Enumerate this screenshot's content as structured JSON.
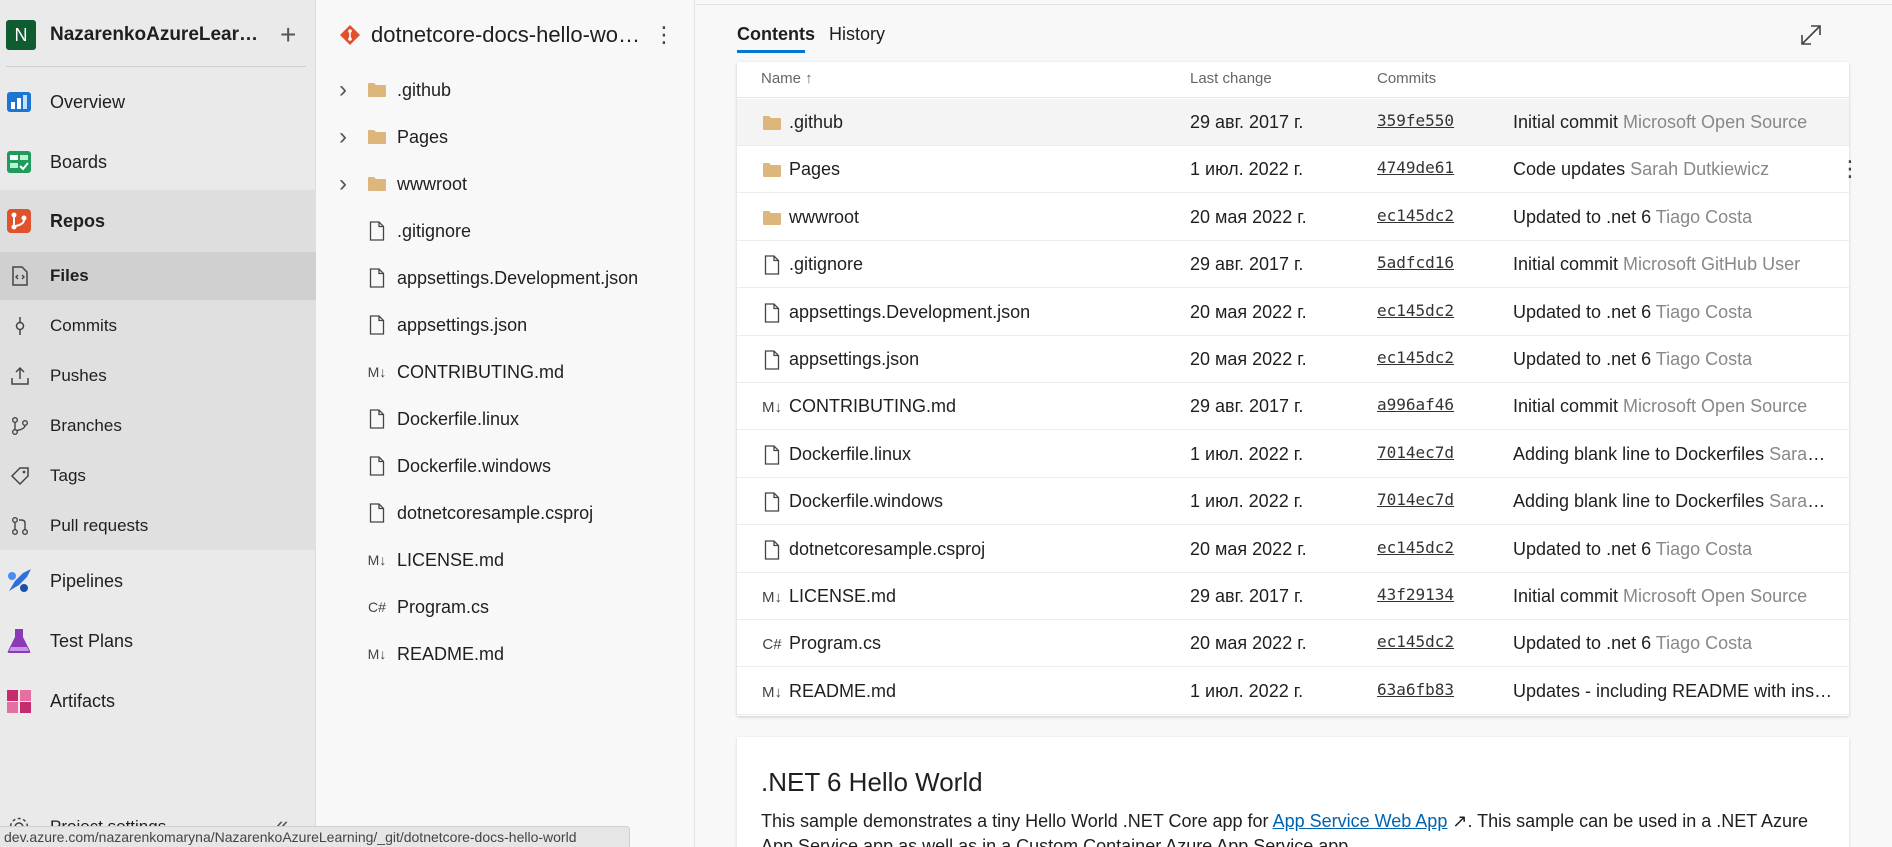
{
  "org": {
    "initial": "N",
    "name": "NazarenkoAzureLearning",
    "add_icon": "plus-icon"
  },
  "nav": {
    "overview": "Overview",
    "boards": "Boards",
    "repos": "Repos",
    "files": "Files",
    "commits": "Commits",
    "pushes": "Pushes",
    "branches": "Branches",
    "tags": "Tags",
    "pull_requests": "Pull requests",
    "pipelines": "Pipelines",
    "test_plans": "Test Plans",
    "artifacts": "Artifacts",
    "project_settings": "Project settings"
  },
  "repo": {
    "name": "dotnetcore-docs-hello-world"
  },
  "tree": [
    {
      "name": ".github",
      "type": "folder"
    },
    {
      "name": "Pages",
      "type": "folder"
    },
    {
      "name": "wwwroot",
      "type": "folder"
    },
    {
      "name": ".gitignore",
      "type": "file"
    },
    {
      "name": "appsettings.Development.json",
      "type": "file"
    },
    {
      "name": "appsettings.json",
      "type": "file"
    },
    {
      "name": "CONTRIBUTING.md",
      "type": "md"
    },
    {
      "name": "Dockerfile.linux",
      "type": "file"
    },
    {
      "name": "Dockerfile.windows",
      "type": "file"
    },
    {
      "name": "dotnetcoresample.csproj",
      "type": "file"
    },
    {
      "name": "LICENSE.md",
      "type": "md"
    },
    {
      "name": "Program.cs",
      "type": "cs"
    },
    {
      "name": "README.md",
      "type": "md"
    }
  ],
  "tabs": {
    "contents": "Contents",
    "history": "History"
  },
  "grid": {
    "headers": {
      "name": "Name ↑",
      "last_change": "Last change",
      "commits": "Commits"
    },
    "rows": [
      {
        "name": ".github",
        "type": "folder",
        "date": "29 авг. 2017 г.",
        "hash": "359fe550",
        "msg": "Initial commit",
        "author": "Microsoft Open Source"
      },
      {
        "name": "Pages",
        "type": "folder",
        "date": "1 июл. 2022 г.",
        "hash": "4749de61",
        "msg": "Code updates",
        "author": "Sarah Dutkiewicz"
      },
      {
        "name": "wwwroot",
        "type": "folder",
        "date": "20 мая 2022 г.",
        "hash": "ec145dc2",
        "msg": "Updated to .net 6",
        "author": "Tiago Costa"
      },
      {
        "name": ".gitignore",
        "type": "file",
        "date": "29 авг. 2017 г.",
        "hash": "5adfcd16",
        "msg": "Initial commit",
        "author": "Microsoft GitHub User"
      },
      {
        "name": "appsettings.Development.json",
        "type": "file",
        "date": "20 мая 2022 г.",
        "hash": "ec145dc2",
        "msg": "Updated to .net 6",
        "author": "Tiago Costa"
      },
      {
        "name": "appsettings.json",
        "type": "file",
        "date": "20 мая 2022 г.",
        "hash": "ec145dc2",
        "msg": "Updated to .net 6",
        "author": "Tiago Costa"
      },
      {
        "name": "CONTRIBUTING.md",
        "type": "md",
        "date": "29 авг. 2017 г.",
        "hash": "a996af46",
        "msg": "Initial commit",
        "author": "Microsoft Open Source"
      },
      {
        "name": "Dockerfile.linux",
        "type": "file",
        "date": "1 июл. 2022 г.",
        "hash": "7014ec7d",
        "msg": "Adding blank line to Dockerfiles",
        "author": "Sarah Dutkiewicz"
      },
      {
        "name": "Dockerfile.windows",
        "type": "file",
        "date": "1 июл. 2022 г.",
        "hash": "7014ec7d",
        "msg": "Adding blank line to Dockerfiles",
        "author": "Sarah Dutkiewicz"
      },
      {
        "name": "dotnetcoresample.csproj",
        "type": "file",
        "date": "20 мая 2022 г.",
        "hash": "ec145dc2",
        "msg": "Updated to .net 6",
        "author": "Tiago Costa"
      },
      {
        "name": "LICENSE.md",
        "type": "md",
        "date": "29 авг. 2017 г.",
        "hash": "43f29134",
        "msg": "Initial commit",
        "author": "Microsoft Open Source"
      },
      {
        "name": "Program.cs",
        "type": "cs",
        "date": "20 мая 2022 г.",
        "hash": "ec145dc2",
        "msg": "Updated to .net 6",
        "author": "Tiago Costa"
      },
      {
        "name": "README.md",
        "type": "md",
        "date": "1 июл. 2022 г.",
        "hash": "63a6fb83",
        "msg": "Updates - including README with instructions",
        "author": ""
      }
    ]
  },
  "readme": {
    "title": ".NET 6 Hello World",
    "text_before": "This sample demonstrates a tiny Hello World .NET Core app for ",
    "link": "App Service Web App",
    "text_after": ". This sample can be used in a .NET Azure App Service app as well as in a Custom Container Azure App Service app."
  },
  "status_url": "dev.azure.com/nazarenkomaryna/NazarenkoAzureLearning/_git/dotnetcore-docs-hello-world",
  "colors": {
    "accent": "#0078d4",
    "folder": "#dcb67a",
    "org_badge": "#0e5c2f"
  }
}
